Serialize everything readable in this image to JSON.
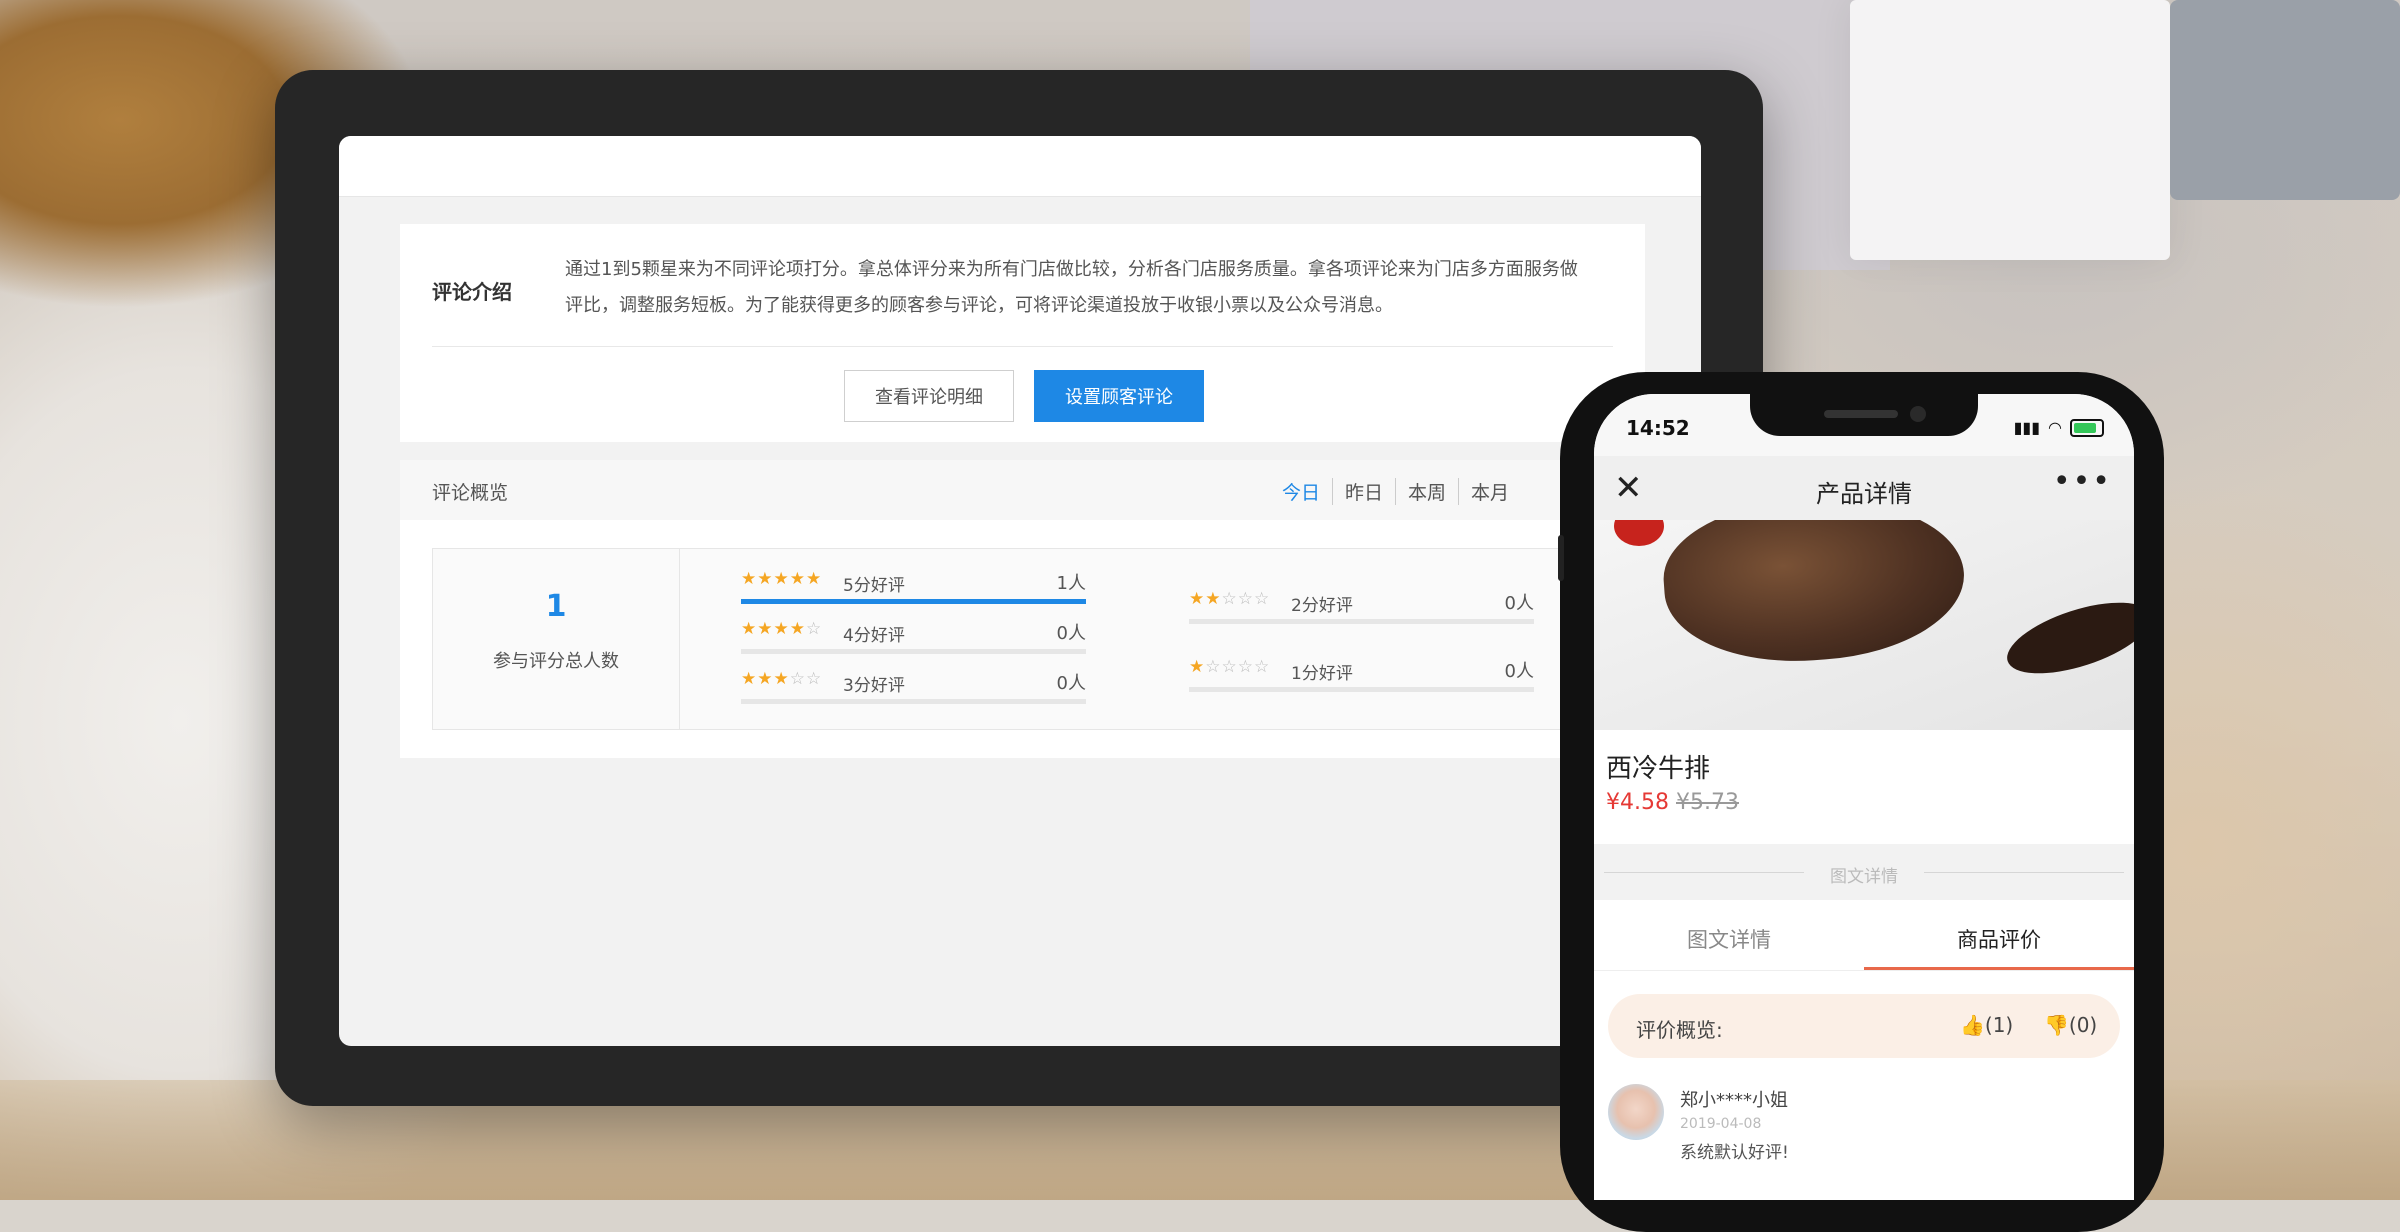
{
  "intro": {
    "title": "评论介绍",
    "text": "通过1到5颗星来为不同评论项打分。拿总体评分来为所有门店做比较，分析各门店服务质量。拿各项评论来为门店多方面服务做评比，调整服务短板。为了能获得更多的顾客参与评论，可将评论渠道投放于收银小票以及公众号消息。",
    "view_detail_button": "查看评论明细",
    "setup_button": "设置顾客评论"
  },
  "overview": {
    "title": "评论概览",
    "tabs": [
      "今日",
      "昨日",
      "本周",
      "本月"
    ],
    "total": "1",
    "total_label": "参与评分总人数",
    "ratings": [
      {
        "stars": 5,
        "label": "5分好评",
        "count": "1人",
        "share": 1.0
      },
      {
        "stars": 4,
        "label": "4分好评",
        "count": "0人",
        "share": 0
      },
      {
        "stars": 3,
        "label": "3分好评",
        "count": "0人",
        "share": 0
      },
      {
        "stars": 2,
        "label": "2分好评",
        "count": "0人",
        "share": 0
      },
      {
        "stars": 1,
        "label": "1分好评",
        "count": "0人",
        "share": 0
      }
    ],
    "accent_color": "#1e88e5"
  },
  "phone": {
    "time": "14:52",
    "nav_title": "产品详情",
    "product_name": "西冷牛排",
    "price": "¥4.58",
    "old_price": "¥5.73",
    "section_label": "图文详情",
    "tabs": [
      "图文详情",
      "商品评价"
    ],
    "summary_label": "评价概览:",
    "likes": "(1)",
    "dislikes": "(0)",
    "review": {
      "name": "郑小****小姐",
      "date": "2019-04-08",
      "text": "系统默认好评!"
    }
  }
}
